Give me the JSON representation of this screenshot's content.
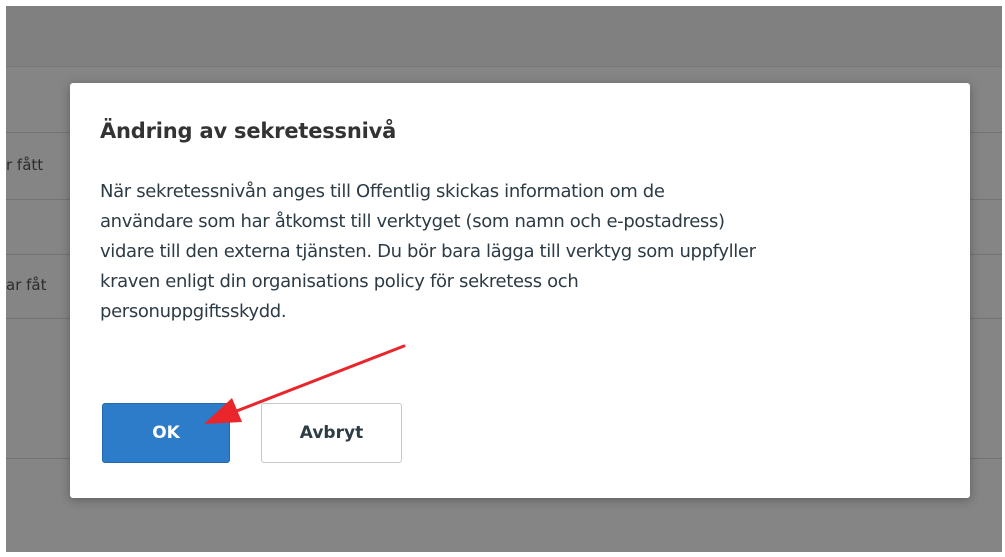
{
  "background": {
    "row_texts": [
      "r fått",
      "ar fåt"
    ]
  },
  "dialog": {
    "title": "Ändring av sekretessnivå",
    "body_lines": [
      "När sekretessnivån anges till Offentlig skickas information om de",
      "användare som har åtkomst till verktyget (som namn och e-postadress)",
      "vidare till den externa tjänsten. Du bör bara lägga till verktyg som uppfyller",
      "kraven enligt din organisations policy för sekretess och",
      "personuppgiftsskydd."
    ],
    "ok_label": "OK",
    "cancel_label": "Avbryt"
  },
  "annotation": {
    "arrow_color": "#e8262b",
    "points_to": "ok-button"
  },
  "colors": {
    "primary_button": "#2d7cc9",
    "overlay": "rgba(0,0,0,0.48)"
  }
}
